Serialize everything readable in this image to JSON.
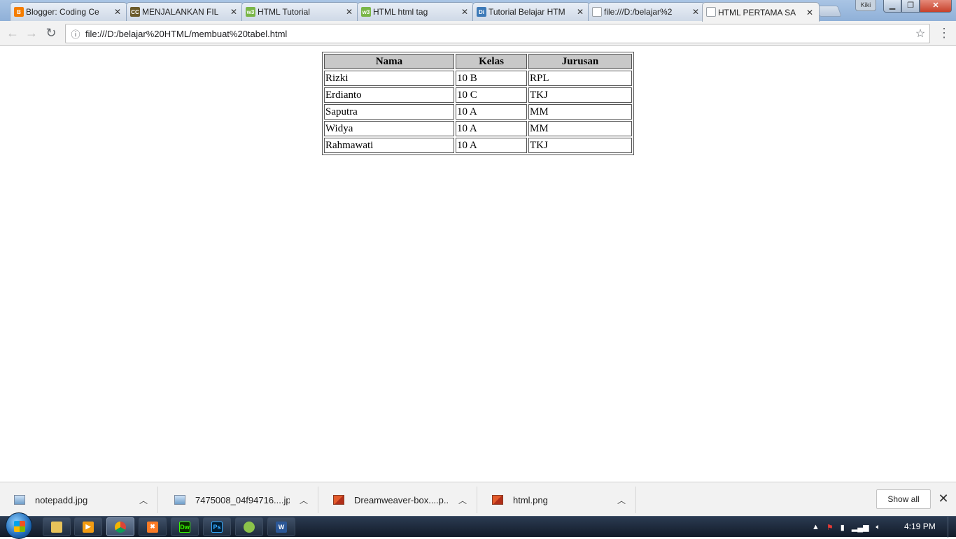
{
  "browser": {
    "tabs": [
      {
        "title": "Blogger: Coding Ce",
        "icon": "blogger-icon",
        "color": "#f57d00",
        "glyph": "B"
      },
      {
        "title": "MENJALANKAN FIL",
        "icon": "codecademy-icon",
        "color": "#6b5b2b",
        "glyph": "CC"
      },
      {
        "title": "HTML Tutorial",
        "icon": "w3schools-icon",
        "color": "#7ab648",
        "glyph": "w3"
      },
      {
        "title": "HTML html tag",
        "icon": "w3schools-icon",
        "color": "#7ab648",
        "glyph": "w3"
      },
      {
        "title": "Tutorial Belajar HTM",
        "icon": "duniailkom-icon",
        "color": "#3d7ab8",
        "glyph": "Di"
      },
      {
        "title": "file:///D:/belajar%2",
        "icon": "file-icon",
        "color": "#9aa0a6",
        "glyph": ""
      },
      {
        "title": "HTML PERTAMA SA",
        "icon": "file-icon",
        "color": "#9aa0a6",
        "glyph": ""
      }
    ],
    "profile_name": "Kiki",
    "url": "file:///D:/belajar%20HTML/membuat%20tabel.html"
  },
  "table": {
    "headers": [
      "Nama",
      "Kelas",
      "Jurusan"
    ],
    "rows": [
      [
        "Rizki",
        "10 B",
        "RPL"
      ],
      [
        "Erdianto",
        "10 C",
        "TKJ"
      ],
      [
        "Saputra",
        "10 A",
        "MM"
      ],
      [
        "Widya",
        "10 A",
        "MM"
      ],
      [
        "Rahmawati",
        "10 A",
        "TKJ"
      ]
    ]
  },
  "downloads": {
    "items": [
      {
        "name": "notepadd.jpg",
        "icon": "image-file-icon"
      },
      {
        "name": "7475008_04f94716....jpg",
        "icon": "image-file-icon"
      },
      {
        "name": "Dreamweaver-box....p...",
        "icon": "photoshop-file-icon"
      },
      {
        "name": "html.png",
        "icon": "photoshop-file-icon"
      }
    ],
    "show_all_label": "Show all"
  },
  "taskbar": {
    "apps": [
      {
        "name": "explorer",
        "glyph": "",
        "color": "#e8c35a"
      },
      {
        "name": "media-player",
        "glyph": "▶",
        "color": "#f39c12"
      },
      {
        "name": "chrome",
        "glyph": "",
        "color": "#4caf50"
      },
      {
        "name": "xampp",
        "glyph": "X",
        "color": "#fb7a24"
      },
      {
        "name": "dreamweaver",
        "glyph": "Dw",
        "color": "#35fa00"
      },
      {
        "name": "photoshop",
        "glyph": "Ps",
        "color": "#2f5fa0"
      },
      {
        "name": "messenger",
        "glyph": "",
        "color": "#8bc34a"
      },
      {
        "name": "word",
        "glyph": "W",
        "color": "#2b5797"
      }
    ],
    "clock": "4:19 PM"
  }
}
